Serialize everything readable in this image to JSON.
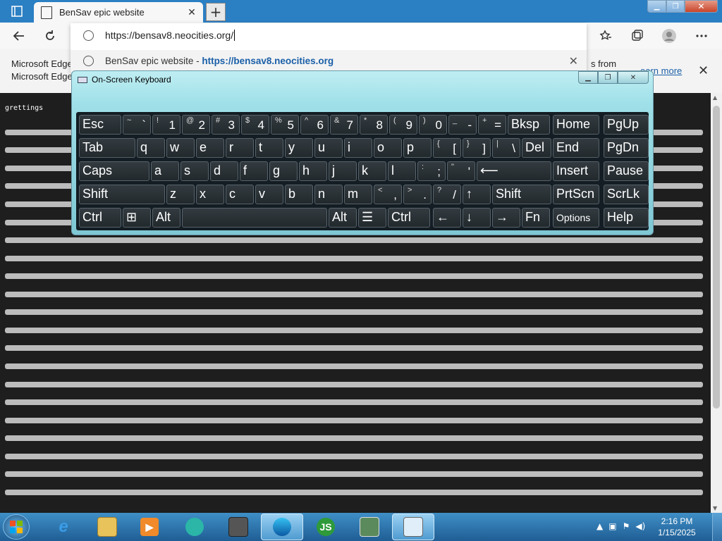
{
  "browser": {
    "tab_title": "BenSav epic website",
    "tab_close": "✕",
    "new_tab": "+",
    "url": "https://bensav8.neocities.org/",
    "suggestion_title": "BenSav epic website - ",
    "suggestion_url": "https://bensav8.neocities.org",
    "window_min": "▁",
    "window_max": "❐",
    "window_close": "✕"
  },
  "toolbar_icons": [
    "back-icon",
    "refresh-icon",
    "favorite-icon",
    "collections-icon",
    "profile-icon",
    "more-icon"
  ],
  "infobar": {
    "line1": "Microsoft Edge",
    "line2": "Microsoft Edge",
    "trail": "s from",
    "learn_more": "earn more"
  },
  "page": {
    "greeting": "grettings",
    "kaomoji_text_visible": true
  },
  "osk": {
    "title": "On-Screen Keyboard",
    "rows": [
      [
        {
          "label": "Esc"
        },
        {
          "sub": "~",
          "main": "`"
        },
        {
          "sub": "!",
          "main": "1"
        },
        {
          "sub": "@",
          "main": "2"
        },
        {
          "sub": "#",
          "main": "3"
        },
        {
          "sub": "$",
          "main": "4"
        },
        {
          "sub": "%",
          "main": "5"
        },
        {
          "sub": "^",
          "main": "6"
        },
        {
          "sub": "&",
          "main": "7"
        },
        {
          "sub": "*",
          "main": "8"
        },
        {
          "sub": "(",
          "main": "9"
        },
        {
          "sub": ")",
          "main": "0"
        },
        {
          "sub": "_",
          "main": "-"
        },
        {
          "sub": "+",
          "main": "="
        },
        {
          "label": "Bksp"
        },
        {
          "label": "Home"
        },
        {
          "label": "PgUp"
        }
      ],
      [
        {
          "label": "Tab"
        },
        {
          "label": "q"
        },
        {
          "label": "w"
        },
        {
          "label": "e"
        },
        {
          "label": "r"
        },
        {
          "label": "t"
        },
        {
          "label": "y"
        },
        {
          "label": "u"
        },
        {
          "label": "i"
        },
        {
          "label": "o"
        },
        {
          "label": "p"
        },
        {
          "sub": "{",
          "main": "["
        },
        {
          "sub": "}",
          "main": "]"
        },
        {
          "sub": "|",
          "main": "\\"
        },
        {
          "label": "Del"
        },
        {
          "label": "End"
        },
        {
          "label": "PgDn"
        }
      ],
      [
        {
          "label": "Caps"
        },
        {
          "label": "a"
        },
        {
          "label": "s"
        },
        {
          "label": "d"
        },
        {
          "label": "f"
        },
        {
          "label": "g"
        },
        {
          "label": "h"
        },
        {
          "label": "j"
        },
        {
          "label": "k"
        },
        {
          "label": "l"
        },
        {
          "sub": ":",
          "main": ";"
        },
        {
          "sub": "\"",
          "main": "'"
        },
        {
          "label": "⟵"
        },
        {
          "label": "Insert"
        },
        {
          "label": "Pause"
        }
      ],
      [
        {
          "label": "Shift"
        },
        {
          "label": "z"
        },
        {
          "label": "x"
        },
        {
          "label": "c"
        },
        {
          "label": "v"
        },
        {
          "label": "b"
        },
        {
          "label": "n"
        },
        {
          "label": "m"
        },
        {
          "sub": "<",
          "main": ","
        },
        {
          "sub": ">",
          "main": "."
        },
        {
          "sub": "?",
          "main": "/"
        },
        {
          "label": "↑"
        },
        {
          "label": "Shift"
        },
        {
          "label": "PrtScn"
        },
        {
          "label": "ScrLk"
        }
      ],
      [
        {
          "label": "Ctrl"
        },
        {
          "label": "⊞"
        },
        {
          "label": "Alt"
        },
        {
          "label": ""
        },
        {
          "label": "Alt"
        },
        {
          "label": "☰"
        },
        {
          "label": "Ctrl"
        },
        {
          "label": "←"
        },
        {
          "label": "↓"
        },
        {
          "label": "→"
        },
        {
          "label": "Fn"
        },
        {
          "label": "Options"
        },
        {
          "label": "Help"
        }
      ]
    ]
  },
  "taskbar": {
    "apps": [
      "internet-explorer-icon",
      "file-explorer-icon",
      "media-player-icon",
      "app-icon-blue",
      "winaso-icon",
      "edge-icon",
      "js-icon",
      "network-computer-icon",
      "keyboard-app-icon"
    ],
    "js_label": "JS",
    "time": "2:16 PM",
    "date": "1/15/2025"
  }
}
